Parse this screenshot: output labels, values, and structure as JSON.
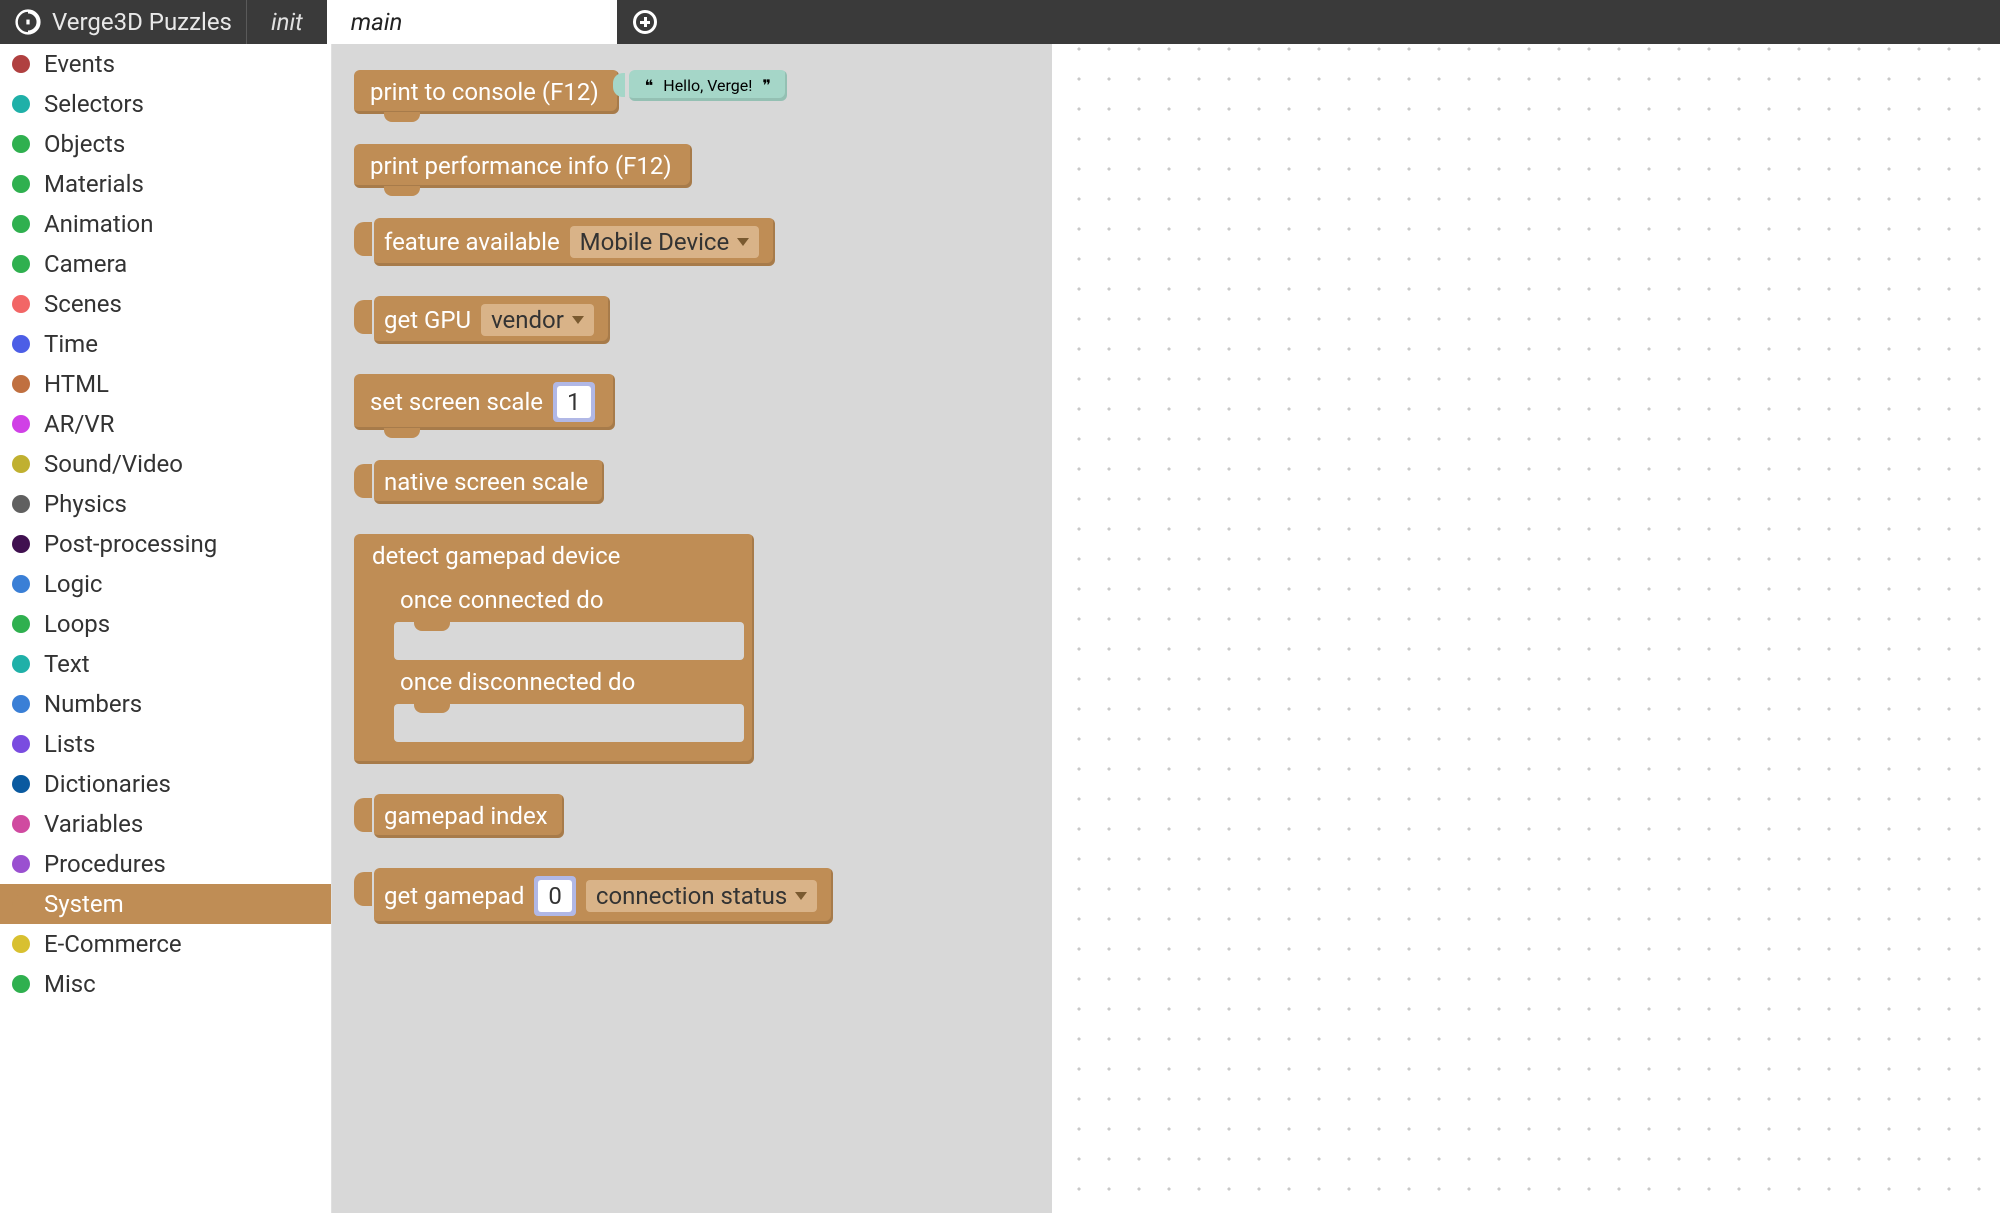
{
  "header": {
    "app_title": "Verge3D Puzzles",
    "tab_init": "init",
    "tab_main": "main"
  },
  "sidebar": {
    "items": [
      {
        "label": "Events",
        "color": "#b04040"
      },
      {
        "label": "Selectors",
        "color": "#1fb0a8"
      },
      {
        "label": "Objects",
        "color": "#2fb04f"
      },
      {
        "label": "Materials",
        "color": "#2fb04f"
      },
      {
        "label": "Animation",
        "color": "#2fb04f"
      },
      {
        "label": "Camera",
        "color": "#2fb04f"
      },
      {
        "label": "Scenes",
        "color": "#f26666"
      },
      {
        "label": "Time",
        "color": "#4c5ee6"
      },
      {
        "label": "HTML",
        "color": "#c07040"
      },
      {
        "label": "AR/VR",
        "color": "#d040e6"
      },
      {
        "label": "Sound/Video",
        "color": "#c0b030"
      },
      {
        "label": "Physics",
        "color": "#606060"
      },
      {
        "label": "Post-processing",
        "color": "#401050"
      },
      {
        "label": "Logic",
        "color": "#3a7fd6"
      },
      {
        "label": "Loops",
        "color": "#2fb04f"
      },
      {
        "label": "Text",
        "color": "#1fb0a8"
      },
      {
        "label": "Numbers",
        "color": "#3a7fd6"
      },
      {
        "label": "Lists",
        "color": "#7a4ce0"
      },
      {
        "label": "Dictionaries",
        "color": "#0a5aa0"
      },
      {
        "label": "Variables",
        "color": "#d04aa0"
      },
      {
        "label": "Procedures",
        "color": "#9a50d0"
      },
      {
        "label": "System",
        "color": "#bf8d55",
        "selected": true
      },
      {
        "label": "E-Commerce",
        "color": "#d8c030"
      },
      {
        "label": "Misc",
        "color": "#2fb04f"
      }
    ]
  },
  "palette": {
    "print_console_label": "print to console (F12)",
    "print_console_value": "Hello, Verge!",
    "print_perf_label": "print performance info (F12)",
    "feature_available_label": "feature available",
    "feature_available_value": "Mobile Device",
    "get_gpu_label": "get GPU",
    "get_gpu_value": "vendor",
    "set_screen_scale_label": "set screen scale",
    "set_screen_scale_value": "1",
    "native_screen_scale_label": "native screen scale",
    "detect_gamepad_label": "detect gamepad device",
    "once_connected_label": "once connected do",
    "once_disconnected_label": "once disconnected do",
    "gamepad_index_label": "gamepad index",
    "get_gamepad_label": "get gamepad",
    "get_gamepad_index": "0",
    "get_gamepad_prop": "connection status"
  }
}
